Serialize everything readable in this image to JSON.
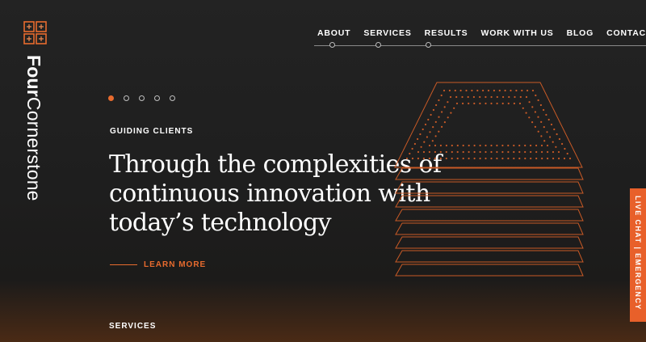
{
  "brand": {
    "name_bold": "Four",
    "name_regular": "Cornerstone",
    "accent_color": "#e86b2e",
    "logo_icon": "four-squares-logo-icon"
  },
  "nav": {
    "items": [
      {
        "label": "ABOUT"
      },
      {
        "label": "SERVICES"
      },
      {
        "label": "RESULTS"
      },
      {
        "label": "WORK WITH US"
      },
      {
        "label": "BLOG"
      },
      {
        "label": "CONTACT"
      }
    ],
    "search_icon": "search-icon"
  },
  "hero": {
    "slides_total": 5,
    "active_slide": 1,
    "eyebrow": "GUIDING CLIENTS",
    "headline": "Through the complexities of continuous innovation with today’s technology",
    "cta_label": "LEARN MORE",
    "illustration_icon": "stacked-chip-layers-icon"
  },
  "live_chat": {
    "label": "LIVE CHAT | EMERGENCY",
    "background": "#e8602a"
  },
  "section": {
    "label": "SERVICES"
  }
}
